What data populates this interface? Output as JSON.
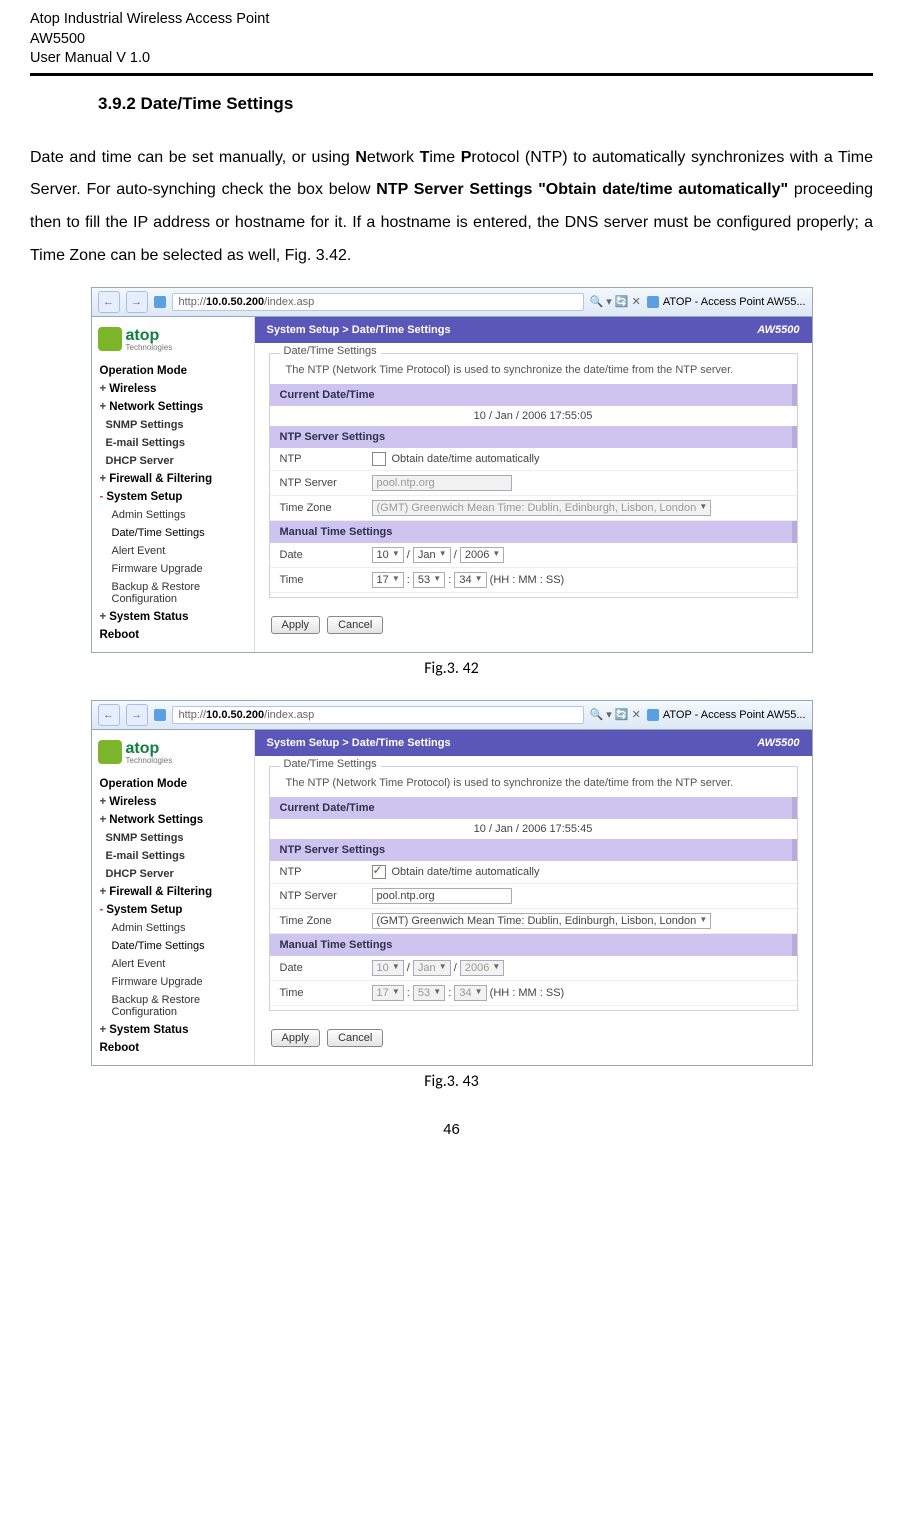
{
  "header": {
    "l1": "Atop Industrial Wireless Access Point",
    "l2": "AW5500",
    "l3": "User Manual V 1.0"
  },
  "section_no": "3.9.2",
  "section_title": "Date/Time Settings",
  "para_pre": "Date and time can be set manually, or using ",
  "para_n": "N",
  "para_etwork": "etwork ",
  "para_t": "T",
  "para_ime": "ime ",
  "para_p": "P",
  "para_rotocol": "rotocol (NTP) to automatically synchronizes with a Time Server. For auto-synching check the box below ",
  "para_ntp": "NTP Server Settings \"Obtain date/time automatically\"",
  "para_post": " proceeding then to fill the IP address or hostname for it. If a hostname is entered, the DNS server must be configured properly; a Time Zone can be selected as well, Fig. 3.42.",
  "cap1": "Fig.3. 42",
  "cap2": "Fig.3. 43",
  "pgnum": "46",
  "url_pre": "http://",
  "url_host": "10.0.50.200",
  "url_path": "/index.asp",
  "search_hint": "🔍 ▾ 🔄 ✕",
  "tab_label": "ATOP - Access Point AW55...",
  "logo": "atop",
  "logo_sub": "Technologies",
  "nav": [
    {
      "t": "Operation Mode",
      "pm": ""
    },
    {
      "t": "Wireless",
      "pm": "+"
    },
    {
      "t": "Network Settings",
      "pm": "+"
    },
    {
      "t": "SNMP Settings",
      "pm": "",
      "sub": true
    },
    {
      "t": "E-mail Settings",
      "pm": "",
      "sub": true
    },
    {
      "t": "DHCP Server",
      "pm": "",
      "sub": true
    },
    {
      "t": "Firewall & Filtering",
      "pm": "+"
    },
    {
      "t": "System Setup",
      "pm": "-",
      "red": true
    },
    {
      "t": "Admin Settings",
      "pm": "",
      "sub": true
    },
    {
      "t": "Date/Time Settings",
      "pm": "",
      "sub": true,
      "active": true
    },
    {
      "t": "Alert Event",
      "pm": "",
      "sub": true
    },
    {
      "t": "Firmware Upgrade",
      "pm": "",
      "sub": true
    },
    {
      "t": "Backup & Restore Configuration",
      "pm": "",
      "sub": true
    },
    {
      "t": "System Status",
      "pm": "+"
    },
    {
      "t": "Reboot",
      "pm": ""
    }
  ],
  "crumb": "System Setup > Date/Time Settings",
  "model": "AW5500",
  "fset_legend": "Date/Time Settings",
  "note": "The NTP (Network Time Protocol) is used to synchronize the date/time from the NTP server.",
  "band_cdt": "Current Date/Time",
  "cdt_val_1": "10 / Jan / 2006 17:55:05",
  "cdt_val_2": "10 / Jan / 2006 17:55:45",
  "band_ntp": "NTP Server Settings",
  "lab_ntp": "NTP",
  "lab_srv": "NTP Server",
  "lab_tz": "Time Zone",
  "obtain": "Obtain date/time automatically",
  "srv_val": "pool.ntp.org",
  "tz_val": "(GMT) Greenwich Mean Time: Dublin, Edinburgh, Lisbon, London",
  "band_man": "Manual Time Settings",
  "lab_date": "Date",
  "lab_time": "Time",
  "d_d": "10",
  "d_m": "Jan",
  "d_y": "2006",
  "t_h": "17",
  "t_m": "53",
  "t_s": "34",
  "t_suf": "(HH : MM : SS)",
  "slash": " / ",
  "colon": " : ",
  "btn_apply": "Apply",
  "btn_cancel": "Cancel"
}
